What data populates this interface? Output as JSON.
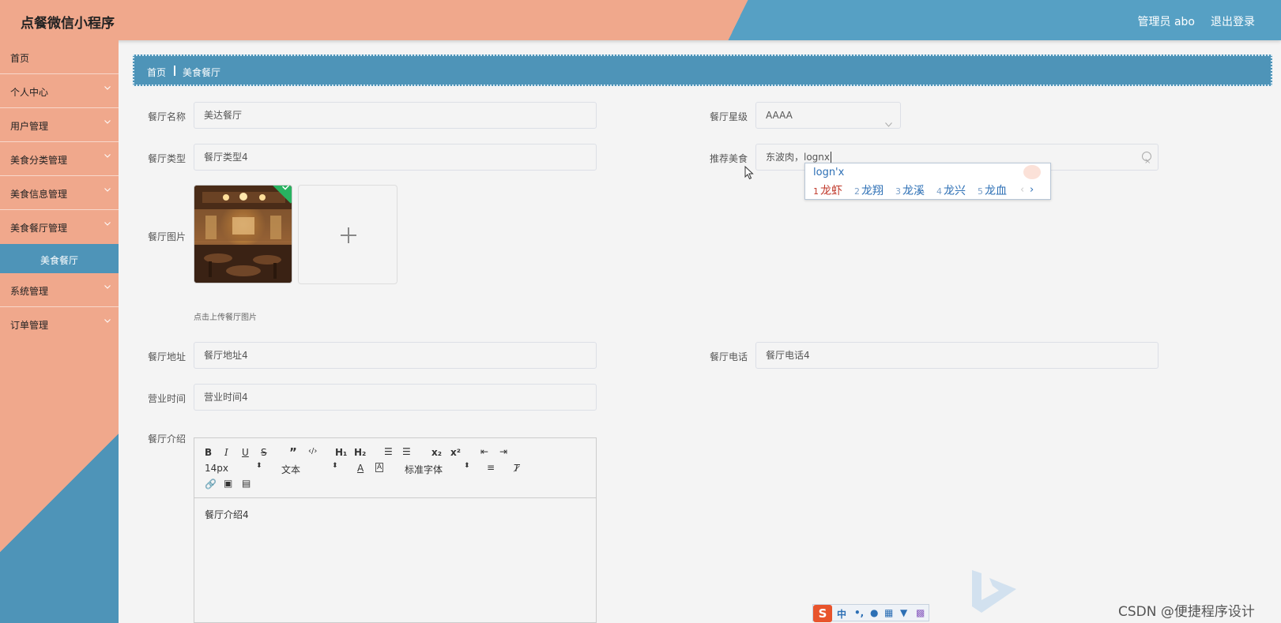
{
  "header": {
    "title": "点餐微信小程序",
    "admin": "管理员 abo",
    "logout": "退出登录"
  },
  "sidebar": {
    "items": [
      {
        "label": "首页"
      },
      {
        "label": "个人中心"
      },
      {
        "label": "用户管理"
      },
      {
        "label": "美食分类管理"
      },
      {
        "label": "美食信息管理"
      },
      {
        "label": "美食餐厅管理"
      },
      {
        "label": "美食餐厅"
      },
      {
        "label": "系统管理"
      },
      {
        "label": "订单管理"
      }
    ]
  },
  "breadcrumb": {
    "home": "首页",
    "current": "美食餐厅"
  },
  "form": {
    "name_label": "餐厅名称",
    "name_value": "美达餐厅",
    "star_label": "餐厅星级",
    "star_value": "AAAA",
    "type_label": "餐厅类型",
    "type_value": "餐厅类型4",
    "recommend_label": "推荐美食",
    "recommend_value": "东波肉，lognx",
    "image_label": "餐厅图片",
    "upload_hint": "点击上传餐厅图片",
    "address_label": "餐厅地址",
    "address_value": "餐厅地址4",
    "phone_label": "餐厅电话",
    "phone_value": "餐厅电话4",
    "hours_label": "营业时间",
    "hours_value": "营业时间4",
    "intro_label": "餐厅介绍",
    "intro_value": "餐厅介绍4"
  },
  "editor": {
    "font_size": "14px",
    "heading": "文本",
    "font_family": "标准字体"
  },
  "ime": {
    "composition": "logn'x",
    "candidates": [
      {
        "n": "1",
        "text": "龙虾"
      },
      {
        "n": "2",
        "text": "龙翔"
      },
      {
        "n": "3",
        "text": "龙溪"
      },
      {
        "n": "4",
        "text": "龙兴"
      },
      {
        "n": "5",
        "text": "龙血"
      }
    ],
    "bar_mode": "中"
  },
  "watermark": "CSDN @便捷程序设计",
  "colors": {
    "salmon": "#f0a88c",
    "blue": "#4e94b8"
  }
}
